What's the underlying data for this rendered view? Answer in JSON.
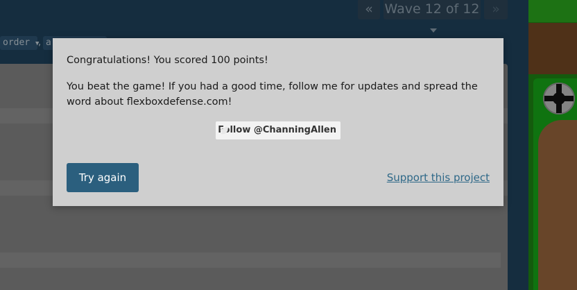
{
  "wave_nav": {
    "prev_glyph": "«",
    "label": "Wave 12 of 12",
    "next_glyph": "»"
  },
  "editor": {
    "chip_1": "order",
    "chip_comma": ",",
    "chip_2": "a"
  },
  "modal": {
    "score_message": "Congratulations! You scored 100 points!",
    "win_message": "You beat the game! If you had a good time, follow me for updates and spread the word about flexboxdefense.com!",
    "follow_label": "Follow @ChanningAllen",
    "try_again_label": "Try again",
    "support_label": "Support this project"
  },
  "colors": {
    "panel_bg": "#1d3d55",
    "modal_bg": "#cfcfcf",
    "primary_button": "#2b5f7e",
    "link": "#2e6888",
    "grass": "#1b7a12",
    "dirt": "#8b5c37"
  }
}
